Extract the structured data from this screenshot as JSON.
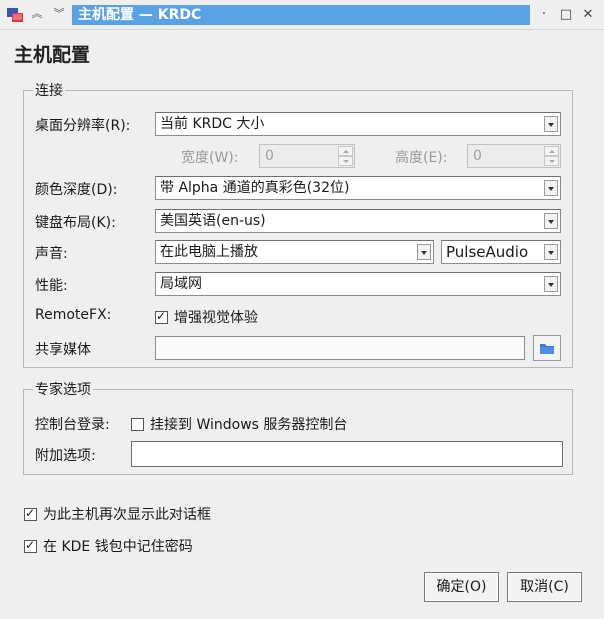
{
  "window": {
    "title": "主机配置 — KRDC",
    "controls": {
      "minimize": "·",
      "maximize": "□",
      "close": "✕"
    }
  },
  "dialog": {
    "heading": "主机配置"
  },
  "connection": {
    "group_label": "连接",
    "resolution": {
      "label": "桌面分辨率(R):",
      "value": "当前 KRDC 大小"
    },
    "width": {
      "label": "宽度(W):",
      "value": "0"
    },
    "height": {
      "label": "高度(E):",
      "value": "0"
    },
    "color_depth": {
      "label": "颜色深度(D):",
      "value": "带 Alpha 通道的真彩色(32位)"
    },
    "keyboard": {
      "label": "键盘布局(K):",
      "value": "美国英语(en-us)"
    },
    "sound": {
      "label": "声音:",
      "value": "在此电脑上播放",
      "backend": "PulseAudio"
    },
    "performance": {
      "label": "性能:",
      "value": "局域网"
    },
    "remotefx": {
      "label": "RemoteFX:",
      "checkbox_label": "增强视觉体验",
      "checked": true
    },
    "share_media": {
      "label": "共享媒体",
      "value": ""
    }
  },
  "expert": {
    "group_label": "专家选项",
    "console_login": {
      "label": "控制台登录:",
      "checkbox_label": "挂接到 Windows 服务器控制台",
      "checked": false
    },
    "extra_options": {
      "label": "附加选项:",
      "value": ""
    }
  },
  "options": {
    "show_dialog": {
      "label": "为此主机再次显示此对话框",
      "checked": true
    },
    "remember_password": {
      "label": "在 KDE 钱包中记住密码",
      "checked": true
    }
  },
  "buttons": {
    "ok": "确定(O)",
    "cancel": "取消(C)"
  },
  "colors": {
    "title_highlight": "#5aa2e6",
    "background": "#efefef",
    "folder_icon": "#3b7bd0"
  }
}
